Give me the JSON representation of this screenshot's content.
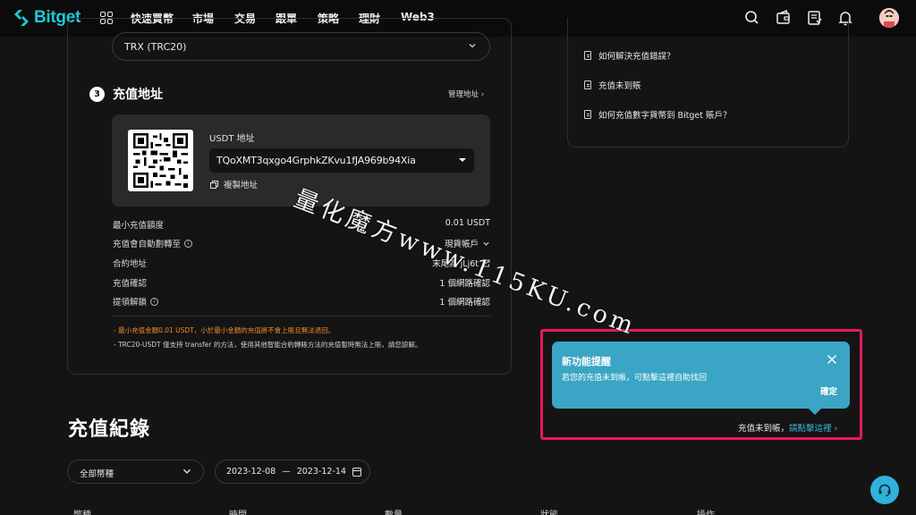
{
  "brand": {
    "name": "Bitget",
    "accent": "#1fc7d4"
  },
  "nav": {
    "items": [
      "快速買幣",
      "市場",
      "交易",
      "跟單",
      "策略",
      "理財",
      "Web3"
    ],
    "icons": [
      "search-icon",
      "wallet-icon",
      "orders-icon",
      "bell-icon"
    ]
  },
  "deposit": {
    "network_value": "TRX (TRC20)",
    "step_number": "3",
    "step_title": "充值地址",
    "manage_link": "管理地址 ›",
    "address_label": "USDT 地址",
    "address_value": "TQoXMT3qxgo4GrphkZKvu1fJA969b94Xia",
    "copy_label": "複製地址",
    "info": [
      {
        "label": "最小充值額度",
        "value": "0.01 USDT"
      },
      {
        "label": "充值會自動劃轉至",
        "value": "現貨帳戶"
      },
      {
        "label": "合約地址",
        "value": "末尾為 jLj6t"
      },
      {
        "label": "充值確認",
        "value": "1 個網路確認"
      },
      {
        "label": "提領解鎖",
        "value": "1 個網路確認"
      }
    ],
    "note_warning": "- 最小充值金額0.01 USDT，小於最小金額的充值將不會上賬且無法退回。",
    "note_info": "- TRC20-USDT 僅支持 transfer 的方法，使用其他智能合約轉賬方法的充值暫時無法上賬，請您諒解。",
    "warning_color": "#f08a2c"
  },
  "faq": {
    "items": [
      "如何解決充值錯誤？",
      "充值未到賬",
      "如何充值數字貨幣到 Bitget 賬戶？"
    ]
  },
  "history": {
    "title": "充值紀錄",
    "coin_filter": "全部幣種",
    "date_start": "2023-12-08",
    "date_sep": "—",
    "date_end": "2023-12-14",
    "columns": [
      "幣種",
      "時間",
      "數量",
      "狀態",
      "操作"
    ]
  },
  "popup": {
    "title": "新功能提醒",
    "body": "若您的充值未到帳，可點擊這裡自助找回",
    "ok_label": "確定",
    "color": "#3aa5c4"
  },
  "findback": {
    "text": "充值未到帳，",
    "link": "請點擊這裡 ›"
  },
  "highlight_color": "#e6195a",
  "watermark": "量化魔方www.115KU.com"
}
